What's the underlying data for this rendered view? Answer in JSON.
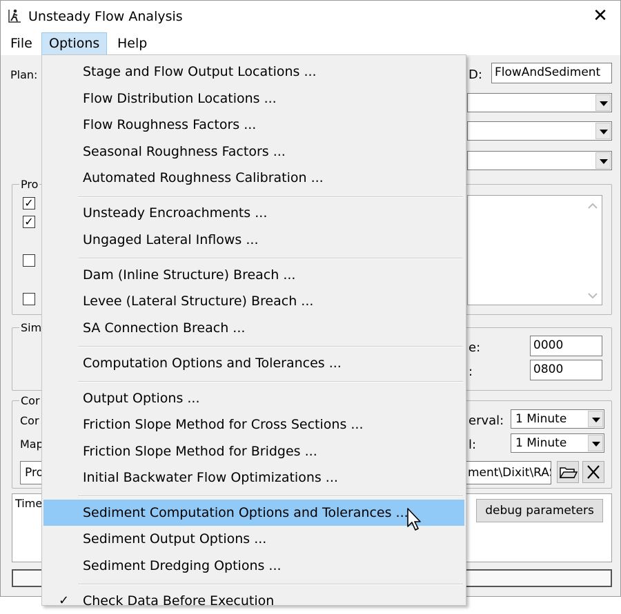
{
  "window": {
    "title": "Unsteady Flow Analysis",
    "close_glyph": "✕"
  },
  "menubar": {
    "file": "File",
    "options": "Options",
    "help": "Help"
  },
  "dialog": {
    "plan_label": "Plan:",
    "short_id_label": "D:",
    "short_id_value": "FlowAndSediment",
    "programs_group": "Pro",
    "sim_group": "Sim",
    "start_time_label": "e:",
    "start_time_value": "0000",
    "end_time_label": ":",
    "end_time_value": "0800",
    "comp_group": "Cor",
    "comp_label": "Cor",
    "map_label": "Map",
    "interval_label_1": "erval:",
    "interval_label_2": "l:",
    "interval_value_1": "1 Minute",
    "interval_value_2": "1 Minute",
    "path_prefix": "Pro",
    "path_value": "ment\\Dixit\\RAS",
    "time_label": "Time",
    "debug_button": "debug parameters"
  },
  "options_menu": {
    "items": [
      {
        "label": "Stage and Flow Output Locations ..."
      },
      {
        "label": "Flow Distribution Locations ..."
      },
      {
        "label": "Flow Roughness Factors ..."
      },
      {
        "label": "Seasonal Roughness Factors ..."
      },
      {
        "label": "Automated Roughness Calibration ..."
      },
      {
        "label": "Unsteady Encroachments ..."
      },
      {
        "label": "Ungaged Lateral Inflows ..."
      },
      {
        "label": "Dam (Inline Structure) Breach ..."
      },
      {
        "label": "Levee (Lateral Structure) Breach ..."
      },
      {
        "label": "SA Connection Breach ..."
      },
      {
        "label": "Computation Options and Tolerances ..."
      },
      {
        "label": "Output Options ..."
      },
      {
        "label": "Friction Slope Method for Cross Sections ..."
      },
      {
        "label": "Friction Slope Method for Bridges ..."
      },
      {
        "label": "Initial Backwater Flow Optimizations ..."
      },
      {
        "label": "Sediment Computation Options and Tolerances ..."
      },
      {
        "label": "Sediment Output Options ..."
      },
      {
        "label": "Sediment Dredging Options ..."
      },
      {
        "label": "Check Data Before Execution"
      }
    ],
    "highlighted": "Sediment Computation Options and Tolerances ..."
  },
  "icons": {
    "app": "hec-ras-person-icon",
    "close": "close-icon",
    "folder": "open-folder-icon",
    "clear": "x-icon",
    "check": "checkmark-icon",
    "cursor": "mouse-pointer-icon"
  }
}
